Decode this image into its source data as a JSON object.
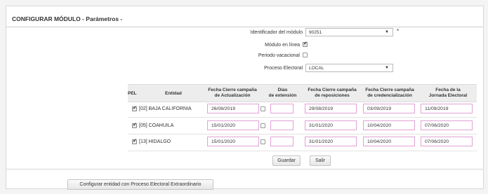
{
  "header": {
    "title": "CONFIGURAR MÓDULO - Parámetros -"
  },
  "form": {
    "identificador_label": "Identificador del módulo",
    "identificador_value": "90251",
    "required_mark": "*",
    "modulo_en_linea_label": "Módulo en línea",
    "modulo_en_linea_checked": true,
    "periodo_vacacional_label": "Periodo vacacional",
    "periodo_vacacional_checked": false,
    "proceso_electoral_label": "Proceso Electoral",
    "proceso_electoral_value": "LOCAL"
  },
  "table": {
    "headers": {
      "pel": "PEL",
      "entidad": "Entidad",
      "actualizacion_l1": "Fecha Cierre campaña",
      "actualizacion_l2": "de Actualización",
      "dias_l1": "Dias",
      "dias_l2": "de extensión",
      "reposiciones_l1": "Fecha Cierre campaña",
      "reposiciones_l2": "de reposiciones",
      "credencializacion_l1": "Fecha Cierre campaña",
      "credencializacion_l2": "de credencialización",
      "jornada_l1": "Fecha de la",
      "jornada_l2": "Jornada Electoral"
    },
    "rows": [
      {
        "pel_checked": true,
        "entidad": "[02] BAJA CALIFORNIA",
        "actualizacion": "26/08/2019",
        "dias_checked": false,
        "dias": "",
        "reposiciones": "29/08/2019",
        "credencializacion": "03/09/2019",
        "jornada": "11/09/2019"
      },
      {
        "pel_checked": true,
        "entidad": "[05] COAHUILA",
        "actualizacion": "15/01/2020",
        "dias_checked": false,
        "dias": "",
        "reposiciones": "31/01/2020",
        "credencializacion": "10/04/2020",
        "jornada": "07/06/2020"
      },
      {
        "pel_checked": true,
        "entidad": "[13] HIDALGO",
        "actualizacion": "15/01/2020",
        "dias_checked": false,
        "dias": "",
        "reposiciones": "31/01/2020",
        "credencializacion": "10/04/2020",
        "jornada": "07/06/2020"
      }
    ]
  },
  "actions": {
    "guardar": "Guardar",
    "salir": "Salir",
    "configurar_extraordinario": "Configurar entidad con Proceso Electoral Extraordinario"
  }
}
